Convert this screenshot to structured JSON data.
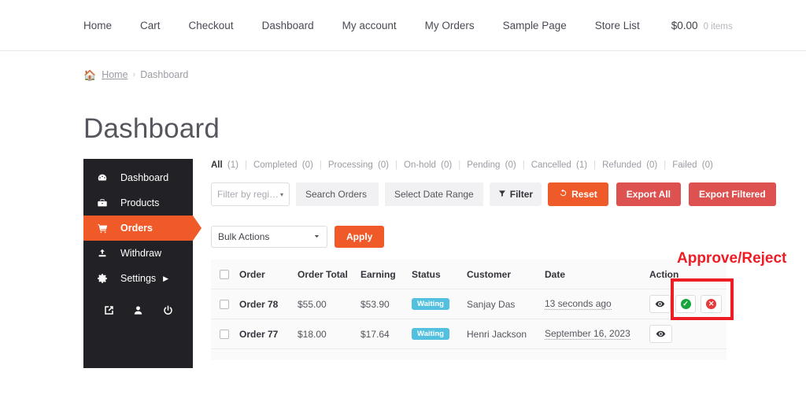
{
  "header": {
    "nav": [
      {
        "label": "Home"
      },
      {
        "label": "Cart"
      },
      {
        "label": "Checkout"
      },
      {
        "label": "Dashboard"
      },
      {
        "label": "My account"
      },
      {
        "label": "My Orders"
      },
      {
        "label": "Sample Page"
      },
      {
        "label": "Store List"
      }
    ],
    "cart_total": "$0.00",
    "cart_items": "0 items",
    "basket_icon": "basket-icon"
  },
  "breadcrumb": {
    "home_icon": "home-icon",
    "home": "Home",
    "separator": "›",
    "current": "Dashboard"
  },
  "page": {
    "title": "Dashboard"
  },
  "sidebar": {
    "items": [
      {
        "label": "Dashboard",
        "icon": "speedometer-icon",
        "glyph": "◔",
        "active": false
      },
      {
        "label": "Products",
        "icon": "briefcase-icon",
        "glyph": "▬",
        "active": false
      },
      {
        "label": "Orders",
        "icon": "cart-icon",
        "glyph": "⛟",
        "active": true
      },
      {
        "label": "Withdraw",
        "icon": "upload-icon",
        "glyph": "⬆",
        "active": false
      },
      {
        "label": "Settings",
        "icon": "gear-icon",
        "glyph": "⚙",
        "active": false,
        "caret": "▶"
      }
    ],
    "utilities": [
      {
        "icon": "external-link-icon",
        "glyph": "↗"
      },
      {
        "icon": "user-icon",
        "glyph": "•"
      },
      {
        "icon": "power-icon",
        "glyph": "⏻"
      }
    ]
  },
  "status_tabs": [
    {
      "name": "All",
      "count": "(1)",
      "active": true
    },
    {
      "name": "Completed",
      "count": "(0)",
      "active": false
    },
    {
      "name": "Processing",
      "count": "(0)",
      "active": false
    },
    {
      "name": "On-hold",
      "count": "(0)",
      "active": false
    },
    {
      "name": "Pending",
      "count": "(0)",
      "active": false
    },
    {
      "name": "Cancelled",
      "count": "(1)",
      "active": false
    },
    {
      "name": "Refunded",
      "count": "(0)",
      "active": false
    },
    {
      "name": "Failed",
      "count": "(0)",
      "active": false
    }
  ],
  "filters": {
    "region_placeholder": "Filter by regi…",
    "region_caret": "▾",
    "search_placeholder": "Search Orders",
    "date_placeholder": "Select Date Range",
    "filter_button": "Filter",
    "filter_icon": "funnel-icon",
    "reset_button": "Reset",
    "reset_icon": "reset-icon",
    "export_all_button": "Export All",
    "export_filtered_button": "Export Filtered"
  },
  "bulk": {
    "select_value": "Bulk Actions",
    "caret": "⌄",
    "apply_button": "Apply"
  },
  "table": {
    "columns": [
      "Order",
      "Order Total",
      "Earning",
      "Status",
      "Customer",
      "Date",
      "Action"
    ],
    "rows": [
      {
        "order": "Order 78",
        "total": "$55.00",
        "earning": "$53.90",
        "status": "Waiting",
        "customer": "Sanjay Das",
        "date": "13 seconds ago",
        "has_approve": true,
        "has_reject": true
      },
      {
        "order": "Order 77",
        "total": "$18.00",
        "earning": "$17.64",
        "status": "Waiting",
        "customer": "Henri Jackson",
        "date": "September 16, 2023",
        "has_approve": false,
        "has_reject": false
      }
    ],
    "action_icons": {
      "view": "eye-icon",
      "approve": "check-circle-icon",
      "reject": "times-circle-icon"
    }
  },
  "annotation": {
    "label": "Approve/Reject",
    "color": "#ee1c25"
  },
  "colors": {
    "accent_orange": "#f05a28",
    "reset_orange": "#ef5a2b",
    "export_red": "#dd5250",
    "badge_cyan": "#53c0e0",
    "sidebar_dark": "#222226",
    "approve_green": "#18a63c",
    "reject_red": "#e8393b",
    "annotation_red": "#ee1c25"
  }
}
